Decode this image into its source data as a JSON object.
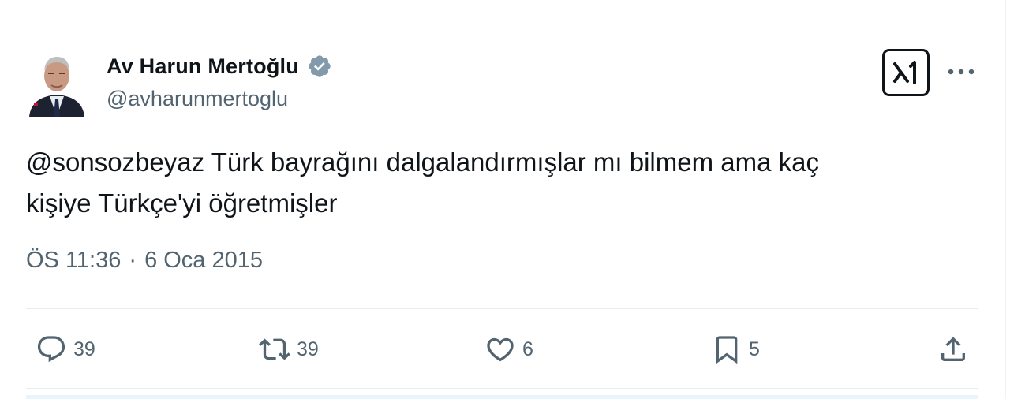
{
  "tweet": {
    "author_name": "Av Harun Mertoğlu",
    "author_handle": "@avharunmertoglu",
    "text_lines": [
      "@sonsozbeyaz Türk bayrağını dalgalandırmışlar mı bilmem ama kaç",
      "kişiye Türkçe'yi öğretmişler"
    ],
    "time": "ÖS 11:36",
    "separator": "·",
    "date": "6 Oca 2015"
  },
  "actions": {
    "replies": "39",
    "retweets": "39",
    "likes": "6",
    "bookmarks": "5"
  },
  "icons": {
    "verified": "verified-badge-icon",
    "grok": "grok-icon",
    "more": "more-dots-icon",
    "reply": "reply-icon",
    "retweet": "retweet-icon",
    "like": "heart-icon",
    "bookmark": "bookmark-icon",
    "share": "share-icon"
  },
  "colors": {
    "text_primary": "#0f1419",
    "text_secondary": "#536471",
    "verified_badge": "#829aab"
  }
}
